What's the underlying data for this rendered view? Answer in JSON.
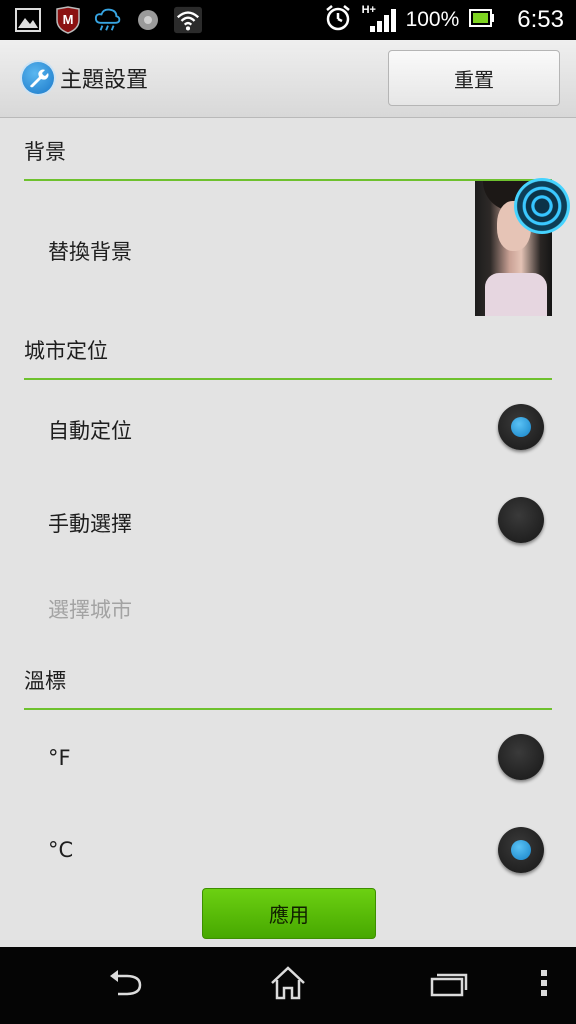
{
  "status_bar": {
    "icons_left": [
      "gallery-icon",
      "mcafee-icon",
      "weather-icon",
      "circle-notification-icon",
      "wifi-icon"
    ],
    "network": "H+",
    "battery": "100%",
    "time": "6:53"
  },
  "action_bar": {
    "title": "主題設置",
    "reset_label": "重置"
  },
  "sections": {
    "background": {
      "title": "背景",
      "replace_label": "替換背景"
    },
    "city": {
      "title": "城市定位",
      "auto_label": "自動定位",
      "auto_selected": true,
      "manual_label": "手動選擇",
      "manual_selected": false,
      "choose_city_label": "選擇城市"
    },
    "temperature": {
      "title": "溫標",
      "f_label": "°F",
      "f_selected": false,
      "c_label": "°C",
      "c_selected": true
    }
  },
  "apply_label": "應用",
  "colors": {
    "accent_green": "#6ec12e",
    "apply_green": "#58bb09",
    "radio_blue": "#1f8fd3"
  }
}
